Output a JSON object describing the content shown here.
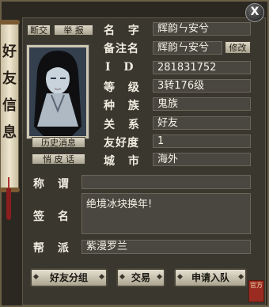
{
  "banner": {
    "title": "好友信息"
  },
  "buttons": {
    "close": "X",
    "block": "断交",
    "report": "举 报",
    "history": "历史消息",
    "whisper": "悄 皮 话",
    "modify": "修改",
    "friend_group": "好友分组",
    "trade": "交易",
    "apply_team": "申请入队"
  },
  "fields": {
    "name": {
      "label": "名  字",
      "value": "辉韵ㄣ安兮"
    },
    "remark": {
      "label": "备注名",
      "value": "辉韵ㄣ安兮"
    },
    "id": {
      "label": "I  D",
      "value": "281831752"
    },
    "level": {
      "label": "等  级",
      "value": "3转176级"
    },
    "race": {
      "label": "种  族",
      "value": "鬼族"
    },
    "relation": {
      "label": "关  系",
      "value": "好友"
    },
    "friendship": {
      "label": "友好度",
      "value": "1"
    },
    "city": {
      "label": "城  市",
      "value": "海外"
    },
    "title": {
      "label": "称  谓",
      "value": ""
    },
    "signature": {
      "label": "签  名",
      "value": "绝境冰块换年!"
    },
    "guild": {
      "label": "帮  派",
      "value": "紫漫罗兰"
    }
  },
  "seal": {
    "text": "官方"
  },
  "colors": {
    "frame": "#2b2822",
    "panel": "#3a372f",
    "field": "#4a4740",
    "banner": "#efe7cf",
    "tassel": "#8a1d1d"
  }
}
